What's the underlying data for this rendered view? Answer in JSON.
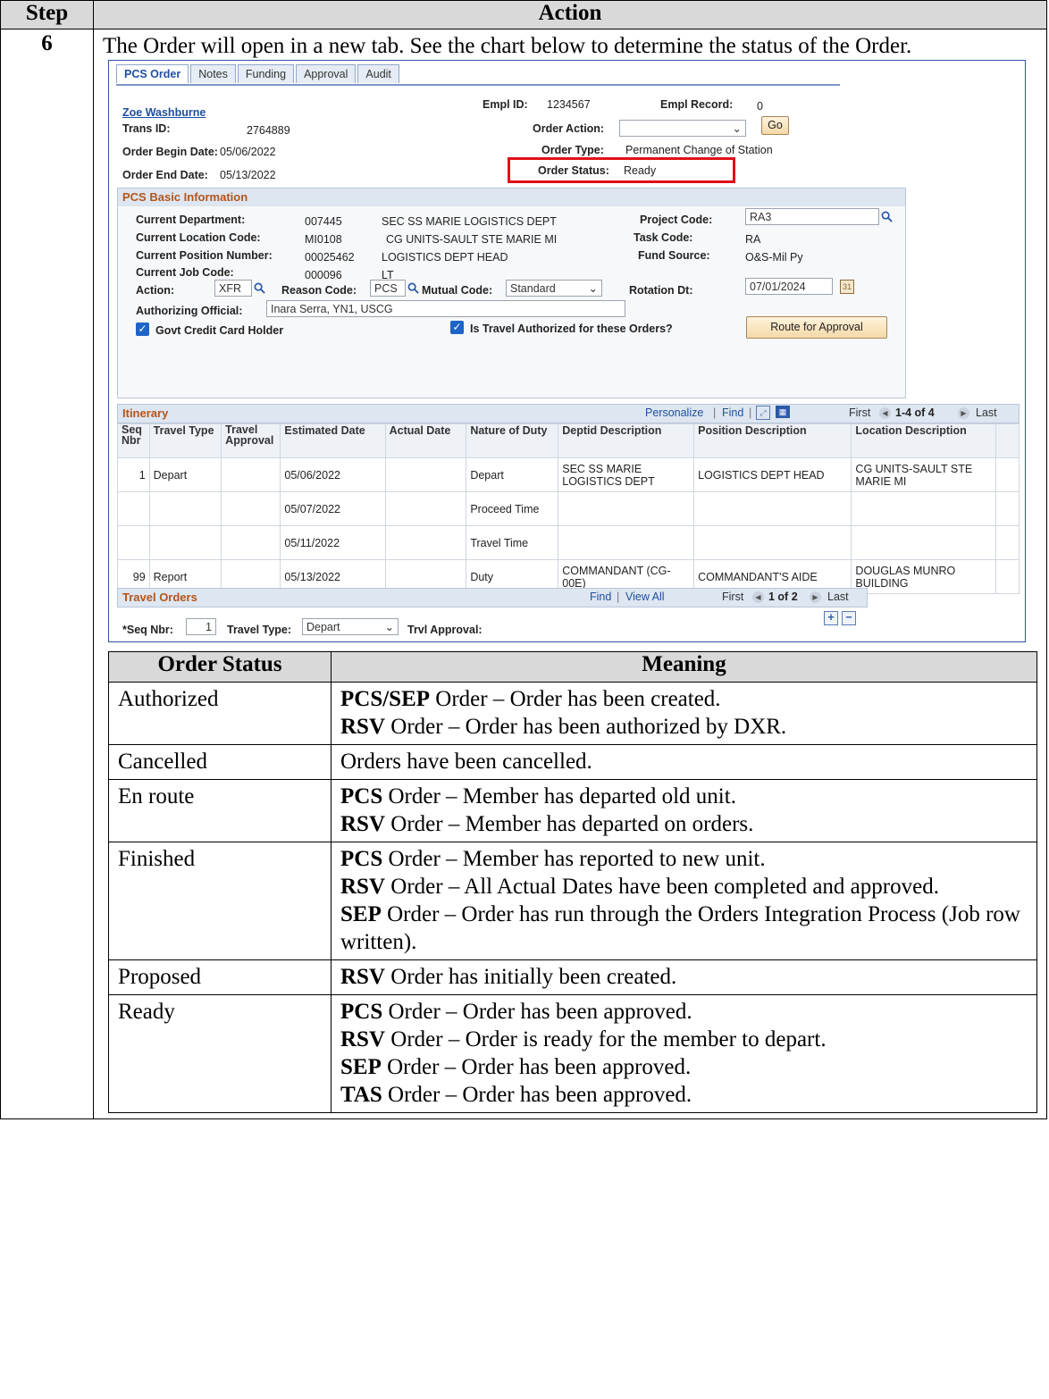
{
  "header": {
    "step": "Step",
    "action": "Action"
  },
  "step_number": "6",
  "intro_text": "The Order will open in a new tab. See the chart below to determine the status of the Order.",
  "screenshot": {
    "tabs": [
      "PCS Order",
      "Notes",
      "Funding",
      "Approval",
      "Audit"
    ],
    "employee_name": "Zoe Washburne",
    "empl_id_label": "Empl ID:",
    "empl_id": "1234567",
    "empl_record_label": "Empl Record:",
    "empl_record": "0",
    "trans_id_label": "Trans ID:",
    "trans_id": "2764889",
    "order_action_label": "Order Action:",
    "order_action_value": "",
    "go_label": "Go",
    "order_begin_label": "Order Begin Date:",
    "order_begin": "05/06/2022",
    "order_type_label": "Order Type:",
    "order_type": "Permanent Change of Station",
    "order_end_label": "Order End Date:",
    "order_end": "05/13/2022",
    "order_status_label": "Order Status:",
    "order_status": "Ready",
    "basic": {
      "title": "PCS Basic Information",
      "cur_dept_label": "Current Department:",
      "cur_dept_code": "007445",
      "cur_dept_desc": "SEC SS MARIE LOGISTICS DEPT",
      "project_code_label": "Project Code:",
      "project_code": "RA3",
      "cur_loc_label": "Current Location Code:",
      "cur_loc_code": "MI0108",
      "cur_loc_desc": "CG UNITS-SAULT STE MARIE MI",
      "task_code_label": "Task Code:",
      "task_code": "RA",
      "cur_pos_label": "Current Position Number:",
      "cur_pos_num": "00025462",
      "cur_pos_desc": "LOGISTICS DEPT HEAD",
      "fund_source_label": "Fund Source:",
      "fund_source": "O&S-Mil Py",
      "cur_job_label": "Current Job Code:",
      "cur_job_code": "000096",
      "cur_job_desc": "LT",
      "action_label": "Action:",
      "action_value": "XFR",
      "reason_label": "Reason Code:",
      "reason_value": "PCS",
      "mutual_label": "Mutual Code:",
      "mutual_value": "Standard",
      "rotation_label": "Rotation Dt:",
      "rotation_value": "07/01/2024",
      "auth_official_label": "Authorizing Official:",
      "auth_official_value": "Inara Serra, YN1, USCG",
      "govt_cc_label": "Govt Credit Card Holder",
      "travel_auth_label": "Is Travel Authorized for these Orders?",
      "route_button": "Route for Approval"
    },
    "itinerary": {
      "title": "Itinerary",
      "nav_personalize": "Personalize",
      "nav_sep1": "|",
      "nav_find": "Find",
      "nav_sep2": "|",
      "nav_first": "First",
      "nav_range": "1-4 of 4",
      "nav_last": "Last",
      "columns": [
        "Seq Nbr",
        "Travel Type",
        "Travel Approval",
        "Estimated Date",
        "Actual Date",
        "Nature of Duty",
        "Deptid Description",
        "Position Description",
        "Location Description"
      ],
      "rows": [
        [
          "1",
          "Depart",
          "",
          "05/06/2022",
          "",
          "Depart",
          "SEC SS MARIE LOGISTICS DEPT",
          "LOGISTICS DEPT HEAD",
          "CG UNITS-SAULT STE MARIE MI"
        ],
        [
          "",
          "",
          "",
          "05/07/2022",
          "",
          "Proceed Time",
          "",
          "",
          ""
        ],
        [
          "",
          "",
          "",
          "05/11/2022",
          "",
          "Travel Time",
          "",
          "",
          ""
        ],
        [
          "99",
          "Report",
          "",
          "05/13/2022",
          "",
          "Duty",
          "COMMANDANT (CG-00E)",
          "COMMANDANT'S AIDE",
          "DOUGLAS MUNRO BUILDING"
        ]
      ]
    },
    "travel_orders": {
      "title": "Travel Orders",
      "nav_find": "Find",
      "nav_sep": "|",
      "nav_viewall": "View All",
      "nav_first": "First",
      "nav_range": "1 of 2",
      "nav_last": "Last",
      "seq_label": "*Seq Nbr:",
      "seq_value": "1",
      "travel_type_label": "Travel Type:",
      "travel_type_value": "Depart",
      "trvl_approval_label": "Trvl Approval:"
    }
  },
  "status_table": {
    "headers": [
      "Order Status",
      "Meaning"
    ],
    "rows": [
      {
        "status": "Authorized",
        "lines": [
          {
            "bold": "PCS/SEP",
            "text": " Order – Order has been created."
          },
          {
            "bold": "RSV",
            "text": " Order – Order has been authorized by DXR."
          }
        ]
      },
      {
        "status": "Cancelled",
        "lines": [
          {
            "bold": "",
            "text": "Orders have been cancelled."
          }
        ]
      },
      {
        "status": "En route",
        "lines": [
          {
            "bold": "PCS",
            "text": " Order – Member has departed old unit."
          },
          {
            "bold": "RSV",
            "text": " Order – Member has departed on orders."
          }
        ]
      },
      {
        "status": "Finished",
        "lines": [
          {
            "bold": "PCS",
            "text": " Order – Member has reported to new unit."
          },
          {
            "bold": "RSV",
            "text": " Order – All Actual Dates have been completed and approved."
          },
          {
            "bold": "SEP",
            "text": " Order – Order has run through the Orders Integration Process (Job row written)."
          }
        ]
      },
      {
        "status": "Proposed",
        "lines": [
          {
            "bold": "RSV",
            "text": " Order has initially been created."
          }
        ]
      },
      {
        "status": "Ready",
        "lines": [
          {
            "bold": "PCS",
            "text": " Order – Order has been approved."
          },
          {
            "bold": "RSV",
            "text": " Order – Order is ready for the member to depart."
          },
          {
            "bold": "SEP",
            "text": " Order – Order has been approved."
          },
          {
            "bold": "TAS",
            "text": " Order – Order has been approved."
          }
        ]
      }
    ]
  },
  "colors": {
    "link": "#1f4fa0",
    "group_title": "#b4551b",
    "highlight_box": "#e0101a",
    "checkbox": "#1e64c8"
  }
}
